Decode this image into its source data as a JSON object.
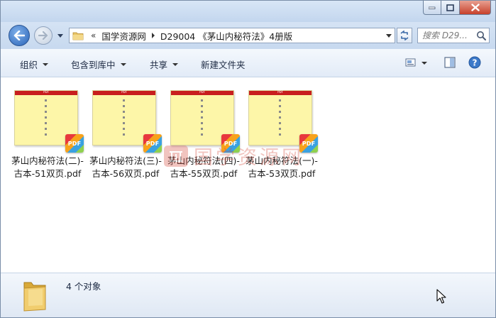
{
  "navigation": {
    "breadcrumbs": [
      "国学资源网",
      "D29004 《茅山内秘符法》4册版"
    ],
    "search_placeholder": "搜索 D29..."
  },
  "toolbar": {
    "organize_label": "组织",
    "include_in_library_label": "包含到库中",
    "share_label": "共享",
    "new_folder_label": "新建文件夹"
  },
  "files": [
    {
      "name_line1": "茅山内秘符法(二)-",
      "name_line2": "古本-51双页.pdf",
      "badge": "PDF"
    },
    {
      "name_line1": "茅山内秘符法(三)-",
      "name_line2": "古本-56双页.pdf",
      "badge": "PDF"
    },
    {
      "name_line1": "茅山内秘符法(四)-",
      "name_line2": "古本-55双页.pdf",
      "badge": "PDF"
    },
    {
      "name_line1": "茅山内秘符法(一)-",
      "name_line2": "古本-53双页.pdf",
      "badge": "PDF"
    }
  ],
  "thumbnail_header": "PDF",
  "watermark": "国学资源网",
  "status": {
    "item_count": "4 个对象"
  },
  "icons": {
    "back": "arrow-left-icon",
    "forward": "arrow-right-icon",
    "refresh": "refresh-icon",
    "search": "search-icon",
    "views": "change-view-icon",
    "preview_pane": "preview-pane-icon",
    "help": "help-icon"
  },
  "colors": {
    "thumbnail_page": "#fdf6a8",
    "thumbnail_header": "#c81e1e",
    "chrome": "#d5e3f4"
  }
}
